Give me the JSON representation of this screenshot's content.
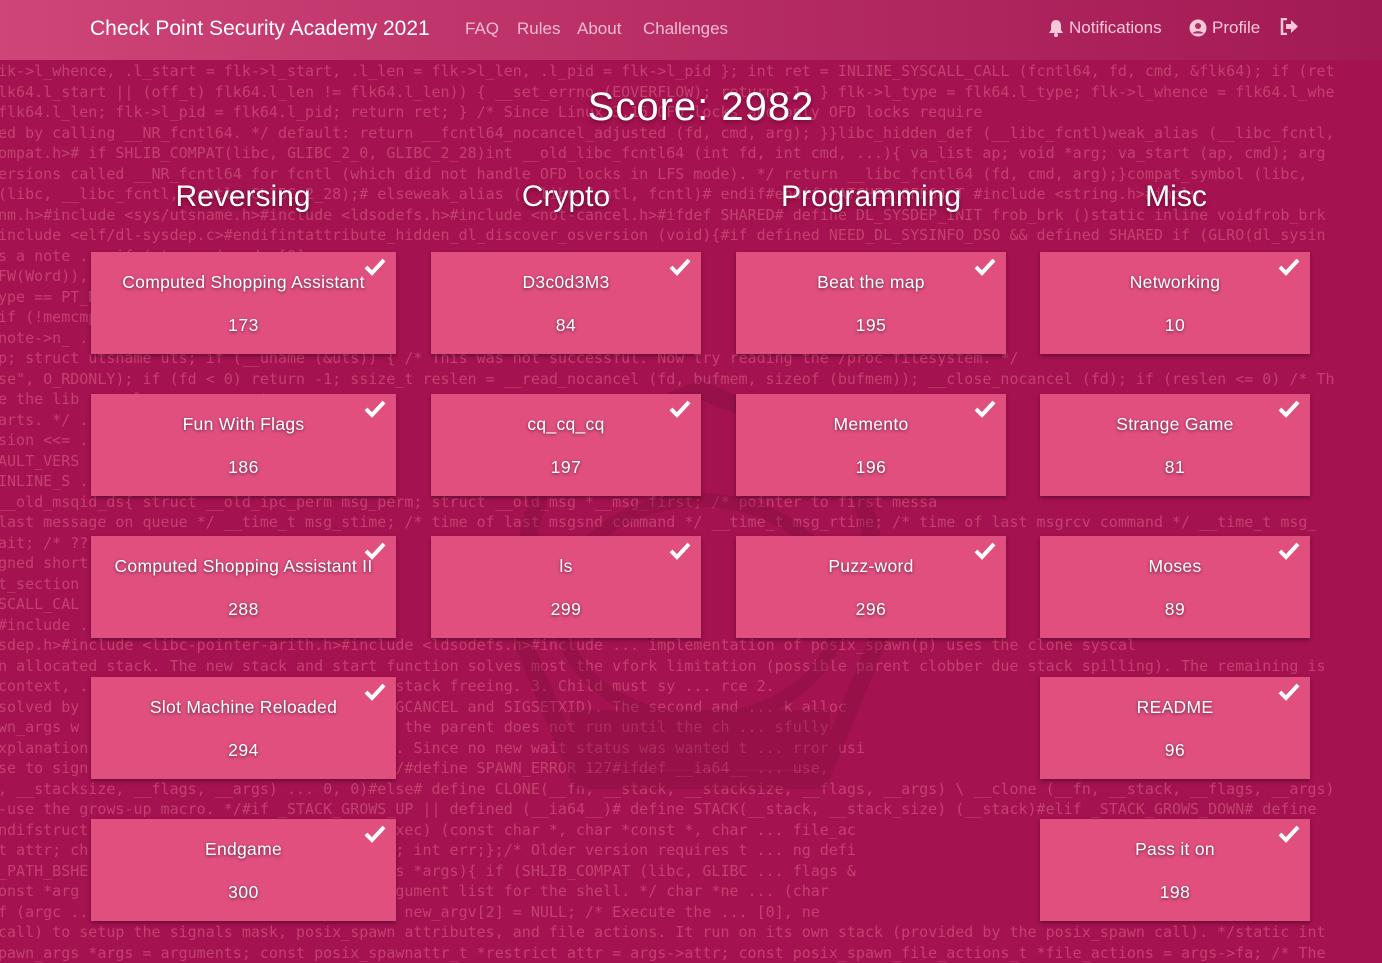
{
  "navbar": {
    "brand": "Check Point Security Academy 2021",
    "links": [
      "FAQ",
      "Rules",
      "About",
      "Challenges"
    ],
    "notifications_label": "Notifications",
    "profile_label": "Profile"
  },
  "score_text": "Score: 2982",
  "categories": [
    "Reversing",
    "Crypto",
    "Programming",
    "Misc"
  ],
  "challenges": {
    "reversing": [
      {
        "name": "Computed Shopping Assistant",
        "points": "173"
      },
      {
        "name": "Fun With Flags",
        "points": "186"
      },
      {
        "name": "Computed Shopping Assistant II",
        "points": "288"
      },
      {
        "name": "Slot Machine Reloaded",
        "points": "294"
      },
      {
        "name": "Endgame",
        "points": "300"
      }
    ],
    "crypto": [
      {
        "name": "D3c0d3M3",
        "points": "84"
      },
      {
        "name": "cq_cq_cq",
        "points": "197"
      },
      {
        "name": "ls",
        "points": "299"
      }
    ],
    "programming": [
      {
        "name": "Beat the map",
        "points": "195"
      },
      {
        "name": "Memento",
        "points": "196"
      },
      {
        "name": "Puzz-word",
        "points": "296"
      }
    ],
    "misc": [
      {
        "name": "Networking",
        "points": "10"
      },
      {
        "name": "Strange Game",
        "points": "81"
      },
      {
        "name": "Moses",
        "points": "89"
      },
      {
        "name": "README",
        "points": "96"
      },
      {
        "name": "Pass it on",
        "points": "198"
      }
    ]
  },
  "background_code": [
    "ik->l_whence, .l_start = flk->l_start, .l_len = flk->l_len, .l_pid = flk->l_pid }; int ret = INLINE_SYSCALL_CALL (fcntl64, fd, cmd, &flk64); if (ret",
    "lk64.l_start || (off_t) flk64.l_len != flk64.l_len)) { __set_errno (EOVERFLOW); return -1; } flk->l_type = flk64.l_type; flk->l_whence = flk64.l_whe",
    " flk64.l_len; flk->l_pid = flk64.l_pid; return ret; } /* Since Linux 3.15 OFD locks and only OFD locks require",
    "ed by calling __NR_fcntl64. */ default: return __fcntl64_nocancel_adjusted (fd, cmd, arg); }}libc_hidden_def (__libc_fcntl)weak_alias (__libc_fcntl,",
    "ompat.h># if SHLIB_COMPAT(libc, GLIBC_2_0, GLIBC_2_28)int __old_libc_fcntl64 (int fd, int cmd, ...){ va_list ap; void *arg; va_start (ap, cmd); arg",
    "ersions called __NR_fcntl64 for fcntl (which did not handle OFD locks in LFS mode). */ return __libc_fcntl64 (fd, cmd, arg);}compat_symbol (libc,",
    " (libc, __libc_fcntl, fcntl, GLIBC_2_28);# elseweak_alias (__libc_fcntl, fcntl)# endif#endif MATCHES_OFF64_T #include <string.h>#inclu",
    "nm.h>#include <sys/utsname.h>#include <ldsodefs.h>#include <not-cancel.h>#ifdef SHARED# define DL_SYSDEP_INIT frob_brk ()static inline voidfrob_brk",
    " include <elf/dl-sysdep.c>#endifintattribute_hidden_dl_discover_osversion (void){#if defined NEED_DL_SYSINFO_DSO && defined SHARED if (GLRO(dl_sysin",
    "s a note ... if (strcmp (vendor[8]",
    "FW(Word)), nhdr; ... for",
    "ype == PT_NOTE) ... while",
    " if (!memcmp ... ROUND(",
    " note->n_ ... char",
    "p; struct utsname uts; if (__uname (&uts)) { /* This was not successful. Now try reading the /proc filesystem. */",
    "se\", O_RDONLY); if (fd < 0) return -1; ssize_t reslen = __read_nocancel (fd, bufmem, sizeof (bufmem)); __close_nocancel (fd); if (reslen <= 0) /* Th",
    "e the lib ... else ... convert",
    "arts. */ ... cp <=",
    "sion <<= ... ); ret",
    "AULT_VERS ... SYSCAL",
    " INLINE_S ... );#if",
    "__old_msqid_ds{ struct __old_ipc_perm msg_perm; struct __old_msg *__msg_first; /* pointer to first messa",
    "last message on queue */ __time_t msg_stime; /* time of last msgsnd command */ __time_t msg_rtime; /* time of last msgrcv command */ __time_t msg_",
    "ait; /* ?? ... int msg",
    "gned short ... msgctl,",
    "t_section ... lude <",
    "SCALL_CAL ... nclude",
    "#include ... ",
    "sdep.h>#include <libc-pointer-arith.h>#include <ldsodefs.h>#include ... implementation of posix_spawn(p) uses the clone syscal",
    "n allocated stack. The new stack and start function solves most the vfork limitation (possible parent clobber due stack spilling). The remaining is",
    " context, ... The parent must ensure child's stack freeing. 3. Child must sy ... rce 2.",
    " solved by ... ven the NPTL-internal ones (SIGCANCEL and SIGSETXID). The second and ... k alloc",
    "wn_args w ... code. CLONE_VFORK ensures that the parent does not run until the ch ... sfully",
    "xplanation ... ter the fork() was successful. Since no new wait status was wanted t ... rror usi",
    "se to sign ... xit with the exit code 127. */#define SPAWN_ERROR 127#ifdef __ia64__ ... use,",
    ", __stacksize, __flags, __args) ... 0, 0)#else# define CLONE(__fn, __stack, __stacksize, __flags, __args) \\ __clone (__fn, __stack, __flags, __args)",
    "-use the grows-up macro. */#if _STACK_GROWS_UP || defined (__ia64__)# define STACK(__stack, __stack_size) (__stack)#elif _STACK_GROWS_DOWN# define",
    "ndifstruct ... sk; const char *file; int (*exec) (const char *, char *const *, char ... file_ac",
    "t attr; ch ... char *const *envp; int xflags; int err;};/* Older version requires t ... ng defi",
    "_PATH_BSHE ... ecute (struct posix_spawn_args *args){ if (SHLIB_COMPAT (libc, GLIBC ... flags &",
    "onst *arg ... args->argc; /* Construct an argument list for the shell. */ char *ne ... (char",
    "f (argc ... 1, argc * sizeof (char *)); else new_argv[2] = NULL; /* Execute the ... [0], ne",
    " call) to setup the signals mask, posix_spawn attributes, and file actions. It run on its own stack (provided by the posix_spawn call). */static int",
    "pawn_args *args = arguments; const posix_spawnattr_t *restrict attr = args->attr; const posix_spawn_file_actions_t *file_actions = args->fa; /* The"
  ]
}
